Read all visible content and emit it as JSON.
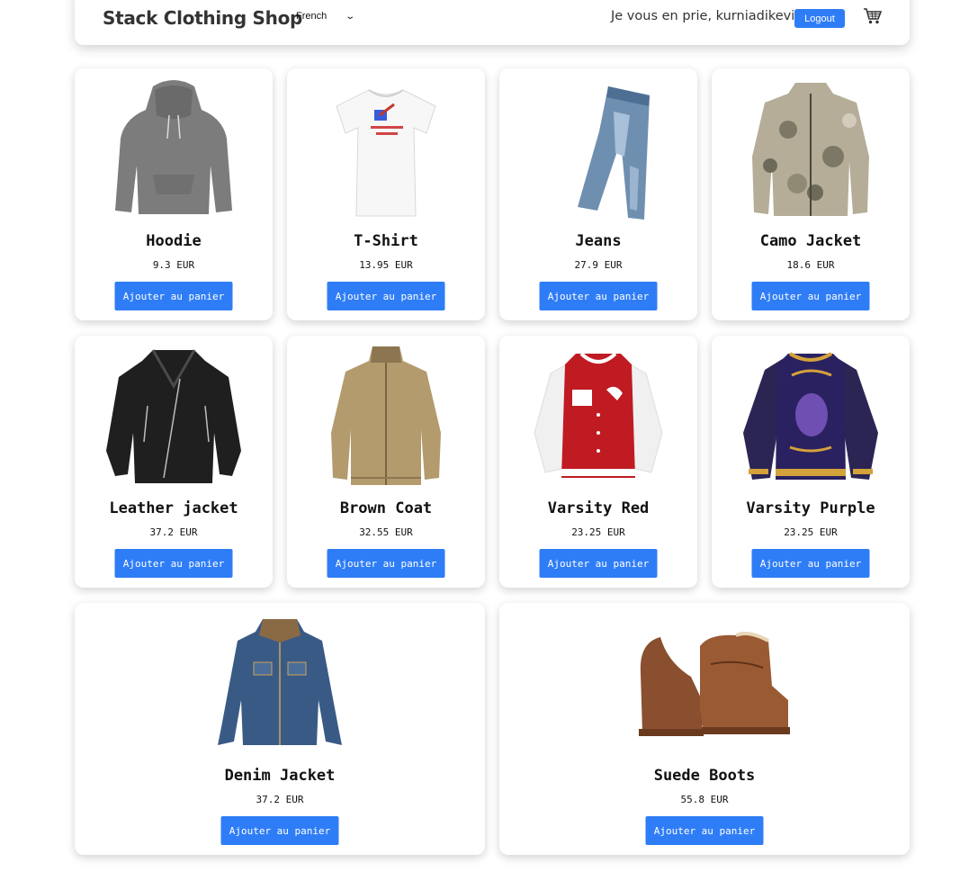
{
  "header": {
    "brand": "Stack Clothing Shop",
    "language": "French",
    "greeting": "Je vous en prie, kurniadikevin",
    "logout_label": "Logout",
    "cart_icon": "cart-icon"
  },
  "colors": {
    "primary": "#2f7df6"
  },
  "products": [
    {
      "name": "Hoodie",
      "price": "9.3 EUR",
      "button": "Ajouter au panier",
      "icon": "hoodie-image"
    },
    {
      "name": "T-Shirt",
      "price": "13.95 EUR",
      "button": "Ajouter au panier",
      "icon": "tshirt-image"
    },
    {
      "name": "Jeans",
      "price": "27.9 EUR",
      "button": "Ajouter au panier",
      "icon": "jeans-image"
    },
    {
      "name": "Camo Jacket",
      "price": "18.6 EUR",
      "button": "Ajouter au panier",
      "icon": "camo-jacket-image"
    },
    {
      "name": "Leather jacket",
      "price": "37.2 EUR",
      "button": "Ajouter au panier",
      "icon": "leather-jacket-image"
    },
    {
      "name": "Brown Coat",
      "price": "32.55 EUR",
      "button": "Ajouter au panier",
      "icon": "brown-coat-image"
    },
    {
      "name": "Varsity Red",
      "price": "23.25 EUR",
      "button": "Ajouter au panier",
      "icon": "varsity-red-image"
    },
    {
      "name": "Varsity Purple",
      "price": "23.25 EUR",
      "button": "Ajouter au panier",
      "icon": "varsity-purple-image"
    },
    {
      "name": "Denim Jacket",
      "price": "37.2 EUR",
      "button": "Ajouter au panier",
      "icon": "denim-jacket-image"
    },
    {
      "name": "Suede Boots",
      "price": "55.8 EUR",
      "button": "Ajouter au panier",
      "icon": "suede-boots-image"
    }
  ]
}
